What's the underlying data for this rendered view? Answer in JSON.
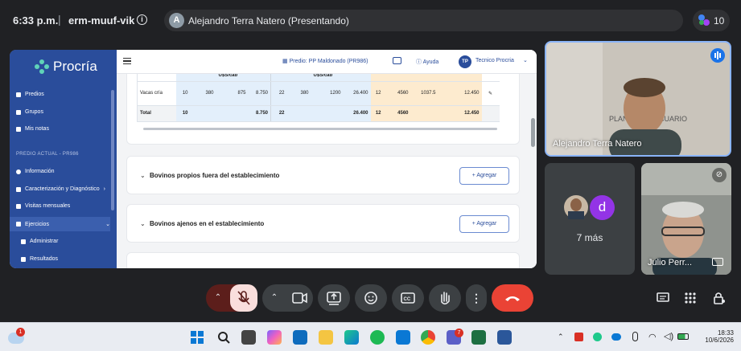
{
  "topbar": {
    "time": "6:33 p.m.",
    "separator": "|",
    "meeting_code": "erm-muuf-vik",
    "presenter_initial": "A",
    "presenter_text": "Alejandro Terra Natero (Presentando)",
    "participant_count": "10"
  },
  "app": {
    "logo_text": "Procría",
    "predio_label": "Predio: PP Maldonado (PR986)",
    "help_label": "Ayuda",
    "user_initials": "TP",
    "user_name": "Tecnico Procria"
  },
  "sidebar": {
    "items": [
      {
        "label": "Predios"
      },
      {
        "label": "Grupos"
      },
      {
        "label": "Mis notas"
      }
    ],
    "section_label": "PREDIO ACTUAL - PR986",
    "predio_items": [
      {
        "label": "Información"
      },
      {
        "label": "Caracterización y Diagnóstico"
      },
      {
        "label": "Visitas mensuales"
      },
      {
        "label": "Ejercicios"
      },
      {
        "label": "Administrar"
      },
      {
        "label": "Resultados"
      }
    ]
  },
  "table": {
    "header": [
      "U$S/cab",
      "U$S/cab"
    ],
    "rows": [
      {
        "label": "Vacas cría",
        "cells": [
          "10",
          "380",
          "875",
          "8.750",
          "22",
          "380",
          "1200",
          "26.400",
          "12",
          "4560",
          "1037.5",
          "12.450"
        ]
      },
      {
        "label": "Total",
        "cells": [
          "10",
          "",
          "",
          "8.750",
          "22",
          "",
          "",
          "26.400",
          "12",
          "4560",
          "",
          "12.450"
        ]
      }
    ]
  },
  "sections": [
    {
      "title": "Bovinos propios fuera del establecimiento",
      "button": "Agregar"
    },
    {
      "title": "Bovinos ajenos en el establecimiento",
      "button": "Agregar"
    }
  ],
  "tiles": {
    "main_name": "Alejandro Terra Natero",
    "more_initial": "d",
    "more_label": "7 más",
    "julio_name": "Julio Perr..."
  },
  "taskbar": {
    "notif_count": "1",
    "teams_badge": "7",
    "clock_time": "18:33",
    "clock_date": "10/6/2026"
  },
  "colors": {
    "sidebar": "#2a4d9b",
    "end_call": "#ea4335",
    "mic_off": "#f9dedc",
    "accent": "#8ab4f8"
  }
}
